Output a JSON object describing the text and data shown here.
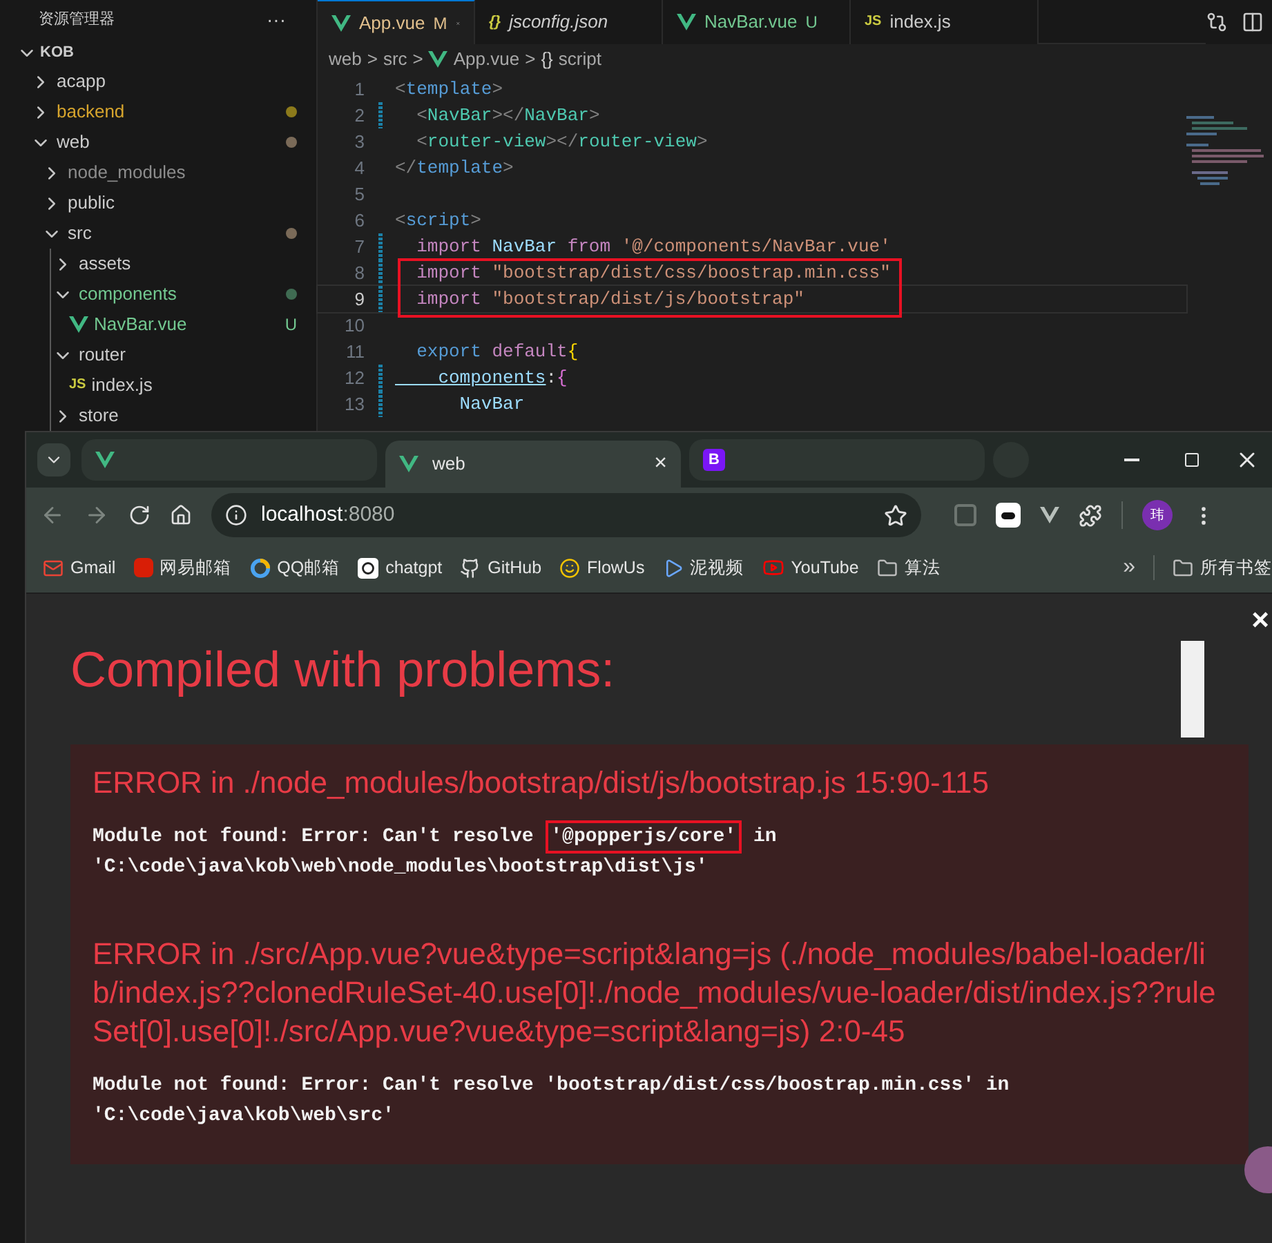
{
  "explorer": {
    "title": "资源管理器",
    "more": "···",
    "root": {
      "label": "KOB",
      "expanded": true,
      "children": [
        {
          "label": "acapp",
          "kind": "folder",
          "expanded": false
        },
        {
          "label": "backend",
          "kind": "folder",
          "expanded": false,
          "color": "#d7a52d",
          "dot": {
            "color": "#8c7a1b"
          }
        },
        {
          "label": "web",
          "kind": "folder",
          "expanded": true,
          "dot": {
            "color": "#7a6a58"
          },
          "children": [
            {
              "label": "node_modules",
              "kind": "folder",
              "expanded": false,
              "color": "#8c8c8c"
            },
            {
              "label": "public",
              "kind": "folder",
              "expanded": false
            },
            {
              "label": "src",
              "kind": "folder",
              "expanded": true,
              "dot": {
                "color": "#7a6a58"
              },
              "children": [
                {
                  "label": "assets",
                  "kind": "folder",
                  "expanded": false
                },
                {
                  "label": "components",
                  "kind": "folder",
                  "expanded": true,
                  "color": "#73c991",
                  "dot": {
                    "color": "#3f6b52"
                  },
                  "children": [
                    {
                      "label": "NavBar.vue",
                      "kind": "vue",
                      "color": "#73c991",
                      "badge": "U"
                    }
                  ]
                },
                {
                  "label": "router",
                  "kind": "folder",
                  "expanded": true,
                  "children": [
                    {
                      "label": "index.js",
                      "kind": "js",
                      "icon_text": "JS"
                    }
                  ]
                },
                {
                  "label": "store",
                  "kind": "folder",
                  "expanded": false
                }
              ]
            }
          ]
        }
      ]
    }
  },
  "editor": {
    "tabs": [
      {
        "label": "App.vue",
        "kind": "vue",
        "badge": "M",
        "selected": true,
        "italic": false,
        "color": "#e2c08d"
      },
      {
        "label": "jsconfig.json",
        "kind": "json",
        "icon_text": "{}",
        "selected": false,
        "italic": true,
        "color": "#cccccc"
      },
      {
        "label": "NavBar.vue",
        "kind": "vue",
        "badge": "U",
        "selected": false,
        "italic": false,
        "color": "#73c991"
      },
      {
        "label": "index.js",
        "kind": "js",
        "icon_text": "JS",
        "selected": false,
        "italic": false,
        "color": "#cccccc"
      }
    ],
    "breadcrumb": [
      {
        "label": "web",
        "kind": "folder"
      },
      {
        "label": "src",
        "kind": "folder"
      },
      {
        "label": "App.vue",
        "kind": "vue"
      },
      {
        "label": "script",
        "kind": "symbol",
        "icon_text": "{}"
      }
    ],
    "breadcrumb_separator": ">",
    "lines": [
      {
        "number": "1",
        "modified": false,
        "current": false,
        "boxed": false,
        "tokens": [
          {
            "text": "<",
            "kind": "punct"
          },
          {
            "text": "template",
            "kind": "tag"
          },
          {
            "text": ">",
            "kind": "punct"
          }
        ]
      },
      {
        "number": "2",
        "modified": true,
        "current": false,
        "boxed": false,
        "tokens": [
          {
            "text": "  <",
            "kind": "punct"
          },
          {
            "text": "NavBar",
            "kind": "component"
          },
          {
            "text": "></",
            "kind": "punct"
          },
          {
            "text": "NavBar",
            "kind": "component"
          },
          {
            "text": ">",
            "kind": "punct"
          }
        ]
      },
      {
        "number": "3",
        "modified": false,
        "current": false,
        "boxed": false,
        "tokens": [
          {
            "text": "  <",
            "kind": "punct"
          },
          {
            "text": "router-view",
            "kind": "component"
          },
          {
            "text": "></",
            "kind": "punct"
          },
          {
            "text": "router-view",
            "kind": "component"
          },
          {
            "text": ">",
            "kind": "punct"
          }
        ]
      },
      {
        "number": "4",
        "modified": false,
        "current": false,
        "boxed": false,
        "tokens": [
          {
            "text": "</",
            "kind": "punct"
          },
          {
            "text": "template",
            "kind": "tag"
          },
          {
            "text": ">",
            "kind": "punct"
          }
        ]
      },
      {
        "number": "5",
        "modified": false,
        "current": false,
        "boxed": false
      },
      {
        "number": "6",
        "modified": false,
        "current": false,
        "boxed": false,
        "tokens": [
          {
            "text": "<",
            "kind": "punct"
          },
          {
            "text": "script",
            "kind": "tag"
          },
          {
            "text": ">",
            "kind": "punct"
          }
        ]
      },
      {
        "number": "7",
        "modified": true,
        "current": false,
        "boxed": false,
        "tokens": [
          {
            "text": "  import",
            "kind": "keyword"
          },
          {
            "text": " NavBar",
            "kind": "ident"
          },
          {
            "text": " from",
            "kind": "keyword"
          },
          {
            "text": " '@/components/NavBar.vue'",
            "kind": "string"
          }
        ]
      },
      {
        "number": "8",
        "modified": true,
        "current": false,
        "boxed": true,
        "tokens": [
          {
            "text": "  import",
            "kind": "keyword"
          },
          {
            "text": " \"bootstrap/dist/css/boostrap.min.css\"",
            "kind": "string"
          }
        ]
      },
      {
        "number": "9",
        "modified": true,
        "current": true,
        "boxed": true,
        "tokens": [
          {
            "text": "  import",
            "kind": "keyword"
          },
          {
            "text": " \"bootstrap/dist/js/bootstrap\"",
            "kind": "string"
          }
        ]
      },
      {
        "number": "10",
        "modified": false,
        "current": false,
        "boxed": false
      },
      {
        "number": "11",
        "modified": false,
        "current": false,
        "boxed": false,
        "tokens": [
          {
            "text": "  export",
            "kind": "tag"
          },
          {
            "text": " default",
            "kind": "keyword"
          },
          {
            "text": "{",
            "kind": "brace"
          }
        ]
      },
      {
        "number": "12",
        "modified": true,
        "current": false,
        "boxed": false,
        "tokens": [
          {
            "text": "    components",
            "kind": "property"
          },
          {
            "text": ":",
            "kind": "plain"
          },
          {
            "text": "{",
            "kind": "brace2"
          }
        ]
      },
      {
        "number": "13",
        "modified": true,
        "current": false,
        "boxed": false,
        "tokens": [
          {
            "text": "      NavBar",
            "kind": "ident"
          }
        ]
      }
    ]
  },
  "browser": {
    "tabs": [
      {
        "kind": "vue",
        "selected": false
      },
      {
        "kind": "vue",
        "title": "web",
        "close": "×",
        "selected": true
      },
      {
        "kind": "bootstrap",
        "icon_text": "B",
        "selected": false
      }
    ],
    "address": {
      "host": "localhost",
      "port": ":8080"
    },
    "avatar": "玮",
    "bookmarks": [
      {
        "label": "Gmail"
      },
      {
        "label": "网易邮箱"
      },
      {
        "label": "QQ邮箱"
      },
      {
        "label": "chatgpt"
      },
      {
        "label": "GitHub"
      },
      {
        "label": "FlowUs"
      },
      {
        "label": "泥视频"
      },
      {
        "label": "YouTube"
      },
      {
        "label": "算法"
      }
    ],
    "overflow": "»",
    "all_bookmarks": "所有书签",
    "page": {
      "title": "Compiled with problems:",
      "close": "×",
      "errors": [
        {
          "header": "ERROR in ./node_modules/bootstrap/dist/js/bootstrap.js 15:90-115",
          "message": [
            {
              "text": "Module not found: Error: Can't resolve ",
              "boxed": false
            },
            {
              "text": "'@popperjs/core'",
              "boxed": true
            },
            {
              "text": " in 'C:\\code\\java\\kob\\web\\node_modules\\bootstrap\\dist\\js'",
              "boxed": false
            }
          ]
        },
        {
          "header": "ERROR in ./src/App.vue?vue&type=script&lang=js (./node_modules/babel-loader/lib/index.js??clonedRuleSet-40.use[0]!./node_modules/vue-loader/dist/index.js??ruleSet[0].use[0]!./src/App.vue?vue&type=script&lang=js) 2:0-45",
          "message": [
            {
              "text": "Module not found: Error: Can't resolve 'bootstrap/dist/css/boostrap.min.css' in 'C:\\code\\java\\kob\\web\\src'",
              "boxed": false
            }
          ]
        }
      ]
    }
  }
}
